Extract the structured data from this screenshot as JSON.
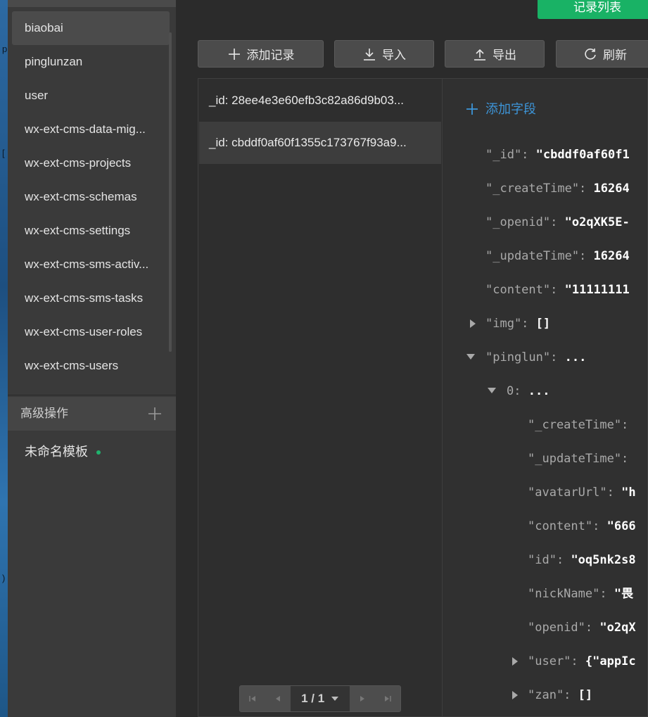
{
  "desktop": {
    "glyphs": [
      "p",
      "[",
      ")"
    ]
  },
  "sidebar": {
    "collections": [
      "biaobai",
      "pinglunzan",
      "user",
      "wx-ext-cms-data-mig...",
      "wx-ext-cms-projects",
      "wx-ext-cms-schemas",
      "wx-ext-cms-settings",
      "wx-ext-cms-sms-activ...",
      "wx-ext-cms-sms-tasks",
      "wx-ext-cms-user-roles",
      "wx-ext-cms-users"
    ],
    "selected_collection": "biaobai",
    "advanced_title": "高级操作",
    "template_label": "未命名模板",
    "template_status_color": "#1fb36d"
  },
  "header": {
    "record_list_button": "记录列表",
    "accent": "#19b265"
  },
  "toolbar": {
    "add_record": "添加记录",
    "import": "导入",
    "export": "导出",
    "refresh": "刷新"
  },
  "records": [
    {
      "label": "_id: 28ee4e3e60efb3c82a86d9b03..."
    },
    {
      "label": "_id: cbddf0af60f1355c173767f93a9..."
    }
  ],
  "pager": {
    "label": "1 / 1"
  },
  "detail": {
    "add_field": "添加字段",
    "fields": [
      {
        "key": "\"_id\":",
        "value": "\"cbddf0af60f1"
      },
      {
        "key": "\"_createTime\":",
        "value": "16264"
      },
      {
        "key": "\"_openid\":",
        "value": "\"o2qXK5E-"
      },
      {
        "key": "\"_updateTime\":",
        "value": "16264"
      },
      {
        "key": "\"content\":",
        "value": "\"11111111"
      },
      {
        "key": "\"img\":",
        "value": "[]"
      },
      {
        "key": "\"pinglun\":",
        "value": "..."
      },
      {
        "key": "0:",
        "value": "..."
      },
      {
        "key": "\"_createTime\":",
        "value": ""
      },
      {
        "key": "\"_updateTime\":",
        "value": ""
      },
      {
        "key": "\"avatarUrl\":",
        "value": "\"h"
      },
      {
        "key": "\"content\":",
        "value": "\"666"
      },
      {
        "key": "\"id\":",
        "value": "\"oq5nk2s8"
      },
      {
        "key": "\"nickName\":",
        "value": "\"畏"
      },
      {
        "key": "\"openid\":",
        "value": "\"o2qX"
      },
      {
        "key": "\"user\":",
        "value": "{\"appIc"
      },
      {
        "key": "\"zan\":",
        "value": "[]"
      }
    ]
  }
}
